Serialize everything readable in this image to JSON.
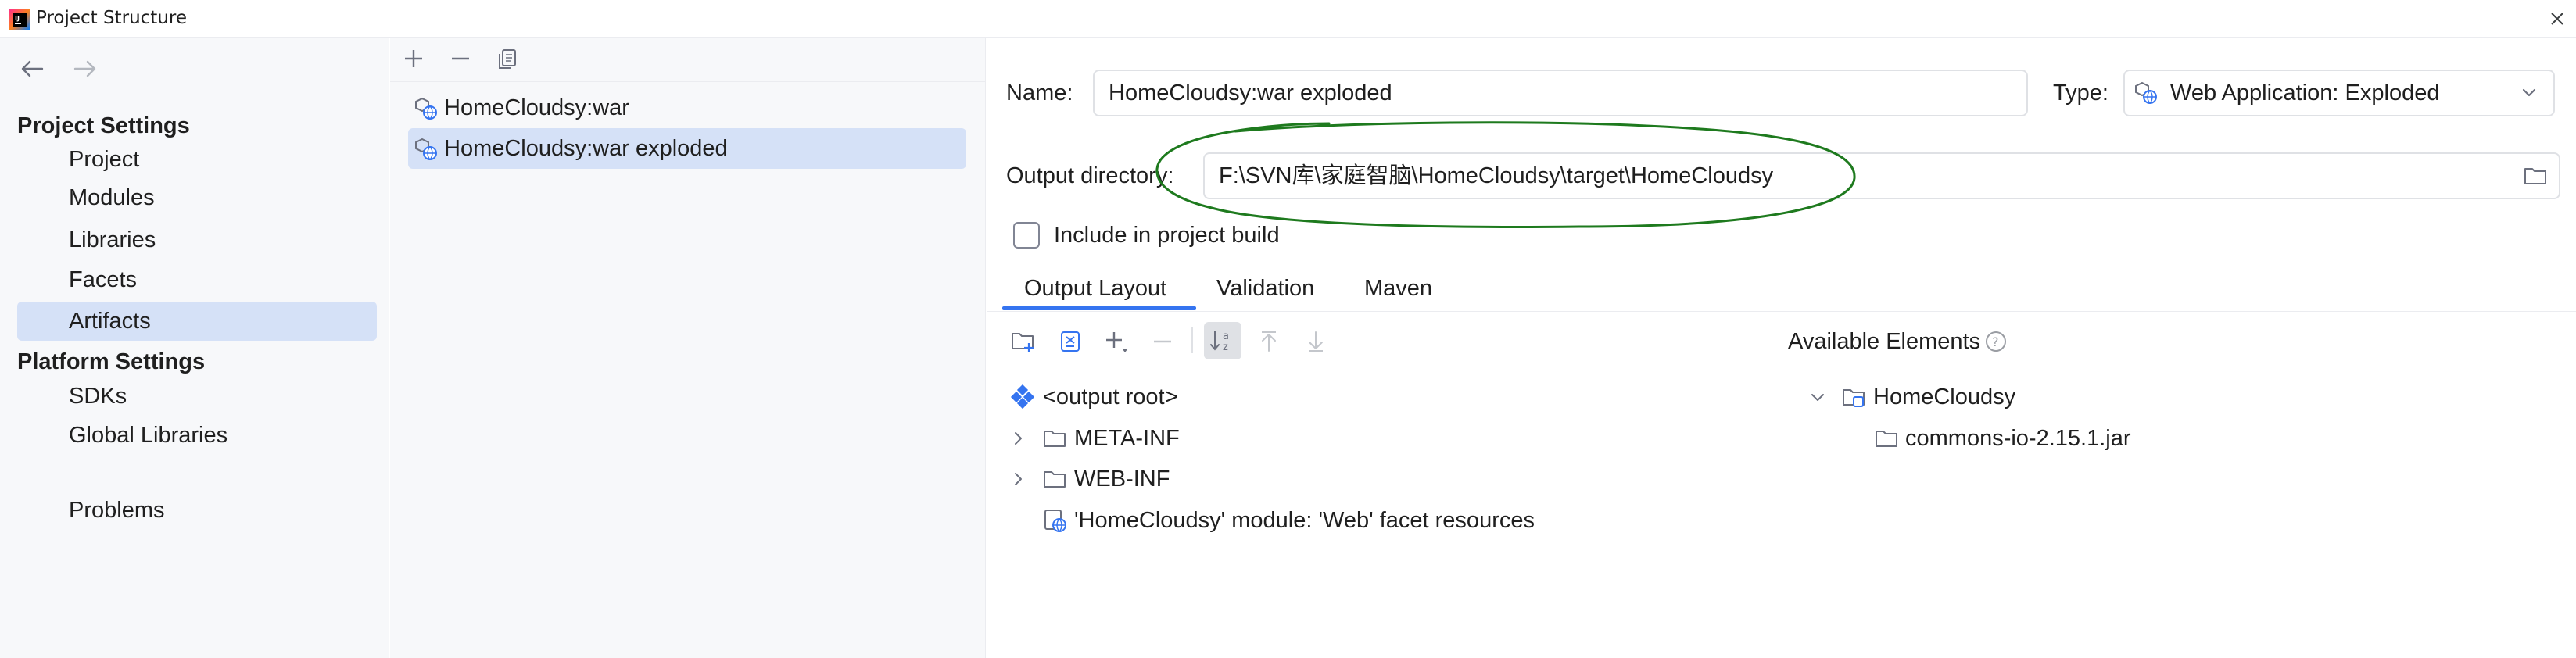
{
  "window": {
    "title": "Project Structure"
  },
  "sidebar": {
    "project_settings_heading": "Project Settings",
    "project_settings_items": [
      {
        "label": "Project"
      },
      {
        "label": "Modules"
      },
      {
        "label": "Libraries"
      },
      {
        "label": "Facets"
      },
      {
        "label": "Artifacts",
        "selected": true
      }
    ],
    "platform_settings_heading": "Platform Settings",
    "platform_settings_items": [
      {
        "label": "SDKs"
      },
      {
        "label": "Global Libraries"
      }
    ],
    "problems_label": "Problems"
  },
  "artifacts": {
    "items": [
      {
        "label": "HomeCloudsy:war",
        "selected": false
      },
      {
        "label": "HomeCloudsy:war exploded",
        "selected": true
      }
    ]
  },
  "details": {
    "name_label": "Name:",
    "name_value": "HomeCloudsy:war exploded",
    "type_label": "Type:",
    "type_value": "Web Application: Exploded",
    "output_dir_label": "Output directory:",
    "output_dir_value": "F:\\SVN库\\家庭智脑\\HomeCloudsy\\target\\HomeCloudsy",
    "include_in_build_label": "Include in project build",
    "include_in_build_checked": false,
    "tabs": [
      {
        "label": "Output Layout",
        "active": true
      },
      {
        "label": "Validation",
        "active": false
      },
      {
        "label": "Maven",
        "active": false
      }
    ]
  },
  "output_layout": {
    "root_label": "<output root>",
    "children": [
      {
        "label": "META-INF",
        "expandable": true
      },
      {
        "label": "WEB-INF",
        "expandable": true
      },
      {
        "label": "'HomeCloudsy' module: 'Web' facet resources",
        "expandable": false
      }
    ]
  },
  "available_elements": {
    "heading": "Available Elements",
    "module_label": "HomeCloudsy",
    "jar_label": "commons-io-2.15.1.jar"
  },
  "colors": {
    "selection": "#d5e1f7",
    "accent": "#3574f0",
    "annotation": "#1e7a1e"
  }
}
